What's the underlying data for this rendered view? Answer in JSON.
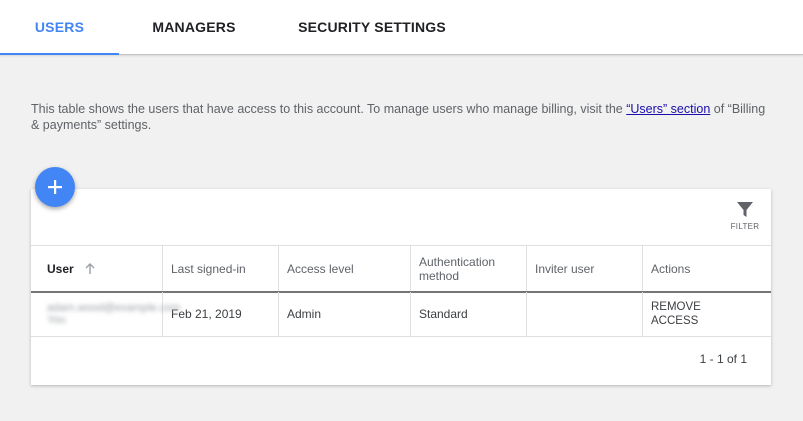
{
  "tabs": [
    {
      "label": "USERS",
      "active": true
    },
    {
      "label": "MANAGERS",
      "active": false
    },
    {
      "label": "SECURITY SETTINGS",
      "active": false
    }
  ],
  "info": {
    "text_before": "This table shows the users that have access to this account. To manage users who manage billing, visit the ",
    "link": "“Users” section",
    "text_after": " of “Billing & payments” settings."
  },
  "fab": {
    "icon": "add-icon"
  },
  "filter": {
    "label": "FILTER",
    "icon": "filter-icon"
  },
  "table": {
    "columns": [
      "User",
      "Last signed-in",
      "Access level",
      "Authentication method",
      "Inviter user",
      "Actions"
    ],
    "rows": [
      {
        "user_email": "adam.wood@example.com",
        "user_note": "You",
        "last_signed_in": "Feb 21, 2019",
        "access_level": "Admin",
        "auth_method": "Standard",
        "inviter": "",
        "action": "REMOVE ACCESS"
      }
    ],
    "pagination": "1 - 1 of 1"
  },
  "colors": {
    "accent": "#4285f4",
    "link": "#1a0dab",
    "background": "#f1f1f1"
  }
}
